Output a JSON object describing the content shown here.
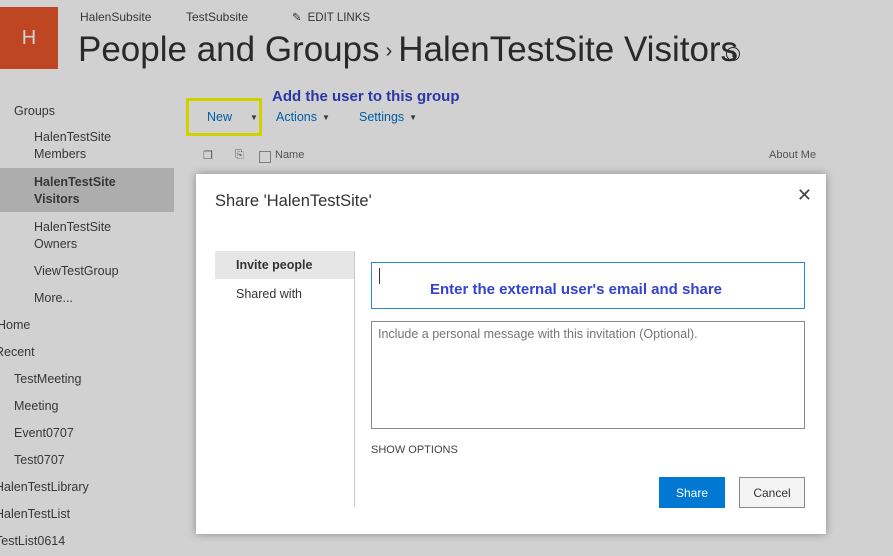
{
  "site": {
    "logo_letter": "H",
    "top_links": [
      "HalenSubsite",
      "TestSubsite"
    ],
    "edit_links": "EDIT LINKS",
    "title_part1": "People and Groups",
    "title_separator": "›",
    "title_part2": "HalenTestSite Visitors",
    "info_icon": "ⓘ"
  },
  "leftnav": {
    "groups_heading": "Groups",
    "items": [
      {
        "label": "HalenTestSite Members"
      },
      {
        "label": "HalenTestSite Visitors",
        "selected": true
      },
      {
        "label": "HalenTestSite Owners"
      },
      {
        "label": "ViewTestGroup"
      },
      {
        "label": "More..."
      },
      {
        "label": "Home"
      },
      {
        "label": "Recent"
      },
      {
        "label": "TestMeeting"
      },
      {
        "label": "Meeting"
      },
      {
        "label": "Event0707"
      },
      {
        "label": "Test0707"
      },
      {
        "label": "HalenTestLibrary"
      },
      {
        "label": "HalenTestList"
      },
      {
        "label": "TestList0614"
      }
    ]
  },
  "toolbar": {
    "new_label": "New",
    "actions_label": "Actions",
    "settings_label": "Settings"
  },
  "list_header": {
    "name": "Name",
    "about_me": "About Me"
  },
  "annotations": {
    "add_user": "Add the user to this group",
    "enter_email": "Enter the external user's email and share"
  },
  "dialog": {
    "title": "Share 'HalenTestSite'",
    "close_icon": "close-icon",
    "tabs": [
      "Invite people",
      "Shared with"
    ],
    "email_value": "",
    "message_placeholder": "Include a personal message with this invitation (Optional).",
    "show_options": "SHOW OPTIONS",
    "share_label": "Share",
    "cancel_label": "Cancel"
  },
  "colors": {
    "logo": "#e8562a",
    "link": "#0072c6",
    "highlight": "#ffff00",
    "annotation": "#3344cc",
    "share_button": "#0078d4"
  }
}
